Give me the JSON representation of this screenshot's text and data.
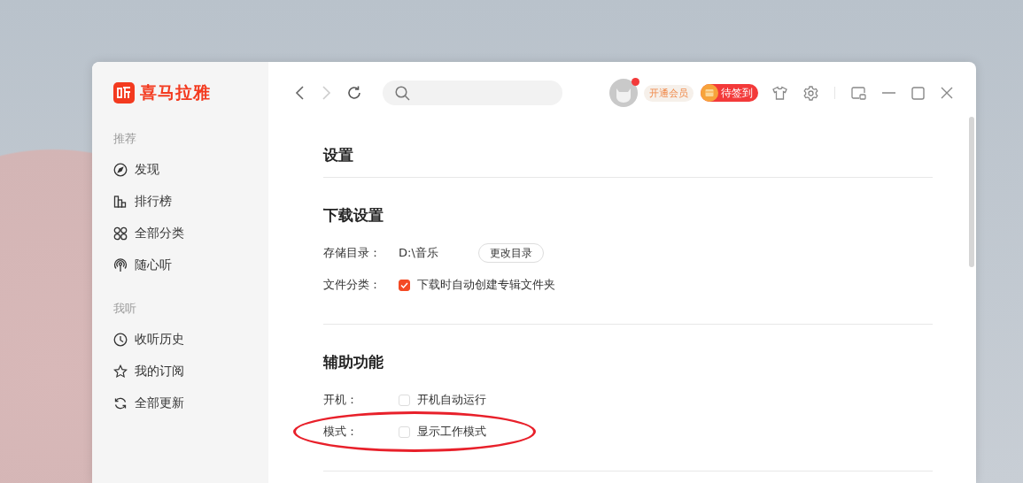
{
  "app": {
    "logo_text": "喜马拉雅"
  },
  "sidebar": {
    "sections": [
      {
        "heading": "推荐",
        "items": [
          {
            "label": "发现",
            "kind": "discover",
            "selected": false
          },
          {
            "label": "排行榜",
            "kind": "ranking",
            "selected": false
          },
          {
            "label": "全部分类",
            "kind": "categories",
            "selected": false
          },
          {
            "label": "随心听",
            "kind": "radio",
            "selected": false
          }
        ]
      },
      {
        "heading": "我听",
        "items": [
          {
            "label": "收听历史",
            "kind": "history",
            "selected": false
          },
          {
            "label": "我的订阅",
            "kind": "subscriptions",
            "selected": false
          },
          {
            "label": "全部更新",
            "kind": "updates",
            "selected": false
          }
        ]
      }
    ]
  },
  "toolbar": {
    "avatar_notification": true,
    "vip_button": "开通会员",
    "signin_button": "待签到"
  },
  "settings": {
    "title": "设置",
    "sections": [
      {
        "title": "下载设置",
        "rows": [
          {
            "label": "存储目录：",
            "kind": "path",
            "value": "D:\\音乐",
            "button": "更改目录"
          },
          {
            "label": "文件分类：",
            "kind": "checkbox",
            "text": "下载时自动创建专辑文件夹",
            "checked": true
          }
        ]
      },
      {
        "title": "辅助功能",
        "rows": [
          {
            "label": "开机：",
            "kind": "checkbox",
            "text": "开机自动运行",
            "checked": false
          },
          {
            "label": "模式：",
            "kind": "checkbox",
            "text": "显示工作模式",
            "checked": false
          }
        ]
      }
    ]
  }
}
